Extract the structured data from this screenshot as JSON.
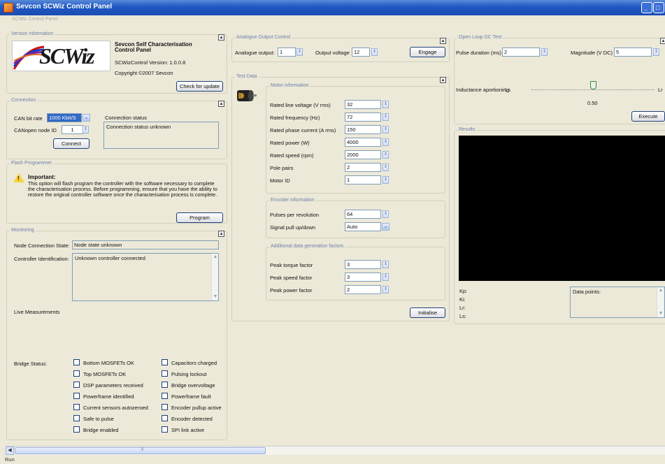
{
  "window": {
    "title": "Sevcon SCWiz Control Panel",
    "minimize": "_",
    "maximize": "□"
  },
  "tab": "SCWiz Control Panel",
  "version": {
    "group_title": "Version Information",
    "logo_text": "SCWiz",
    "product_name": "Sevcon Self Characterisation Control Panel",
    "version_line": "SCWizControl Version: 1.0.0.8",
    "copyright": "Copyright ©2007 Sevcon",
    "check_update": "Check for update"
  },
  "connection": {
    "group_title": "Connection",
    "can_bit_rate_label": "CAN bit rate",
    "can_bit_rate_value": "1000 Kbit/S",
    "node_id_label": "CANopen node ID",
    "node_id_value": "1",
    "connect": "Connect",
    "status_label": "Connection status",
    "status_value": "Connection status unknown"
  },
  "flash": {
    "group_title": "Flash Programmer",
    "important": "Important:",
    "message": "This option will flash program the controller with the software necessary to complete the characterisation process. Before programming, ensure that you have the ability to restore the original controller software once the characterisation process is complete.",
    "program": "Program"
  },
  "monitoring": {
    "group_title": "Monitoring",
    "node_state_label": "Node Connection State:",
    "node_state_value": "Node state unknown",
    "controller_id_label": "Controller Identification:",
    "controller_id_value": "Unknown controller connected",
    "live_label": "Live Measurements",
    "bridge_label": "Bridge Status:",
    "bridge_left": [
      "Bottom MOSFETs OK",
      "Top MOSFETs OK",
      "DSP parameters received",
      "Powerframe identified",
      "Current sensors autozeroed",
      "Safe to pulse",
      "Bridge enabled"
    ],
    "bridge_right": [
      "Capacitors charged",
      "Pulsing lockout",
      "Bridge overvoltage",
      "Powerframe fault",
      "Encoder pullup active",
      "Encoder detected",
      "SPI link active"
    ]
  },
  "analogue": {
    "group_title": "Analogue Output Control",
    "output_label": "Analogue output:",
    "output_value": "1",
    "voltage_label": "Output voltage",
    "voltage_value": "12",
    "engage": "Engage"
  },
  "test_data": {
    "group_title": "Test Data",
    "motor": {
      "title": "Motor information",
      "labels": [
        "Rated line voltage (V rms)",
        "Rated frequency (Hz)",
        "Rated phase current (A rms)",
        "Rated power (W)",
        "Rated speed (rpm)",
        "Pole pairs",
        "Motor ID"
      ],
      "values": [
        "32",
        "72",
        "150",
        "4000",
        "2000",
        "2",
        "1"
      ]
    },
    "encoder": {
      "title": "Encoder information",
      "ppr_label": "Pulses per revolution",
      "ppr_value": "64",
      "pull_label": "Signal pull up/down",
      "pull_value": "Auto"
    },
    "additional": {
      "title": "Additional data generation factors",
      "labels": [
        "Peak torque factor",
        "Peak speed factor",
        "Peak power factor"
      ],
      "values": [
        "3",
        "3",
        "2"
      ]
    },
    "initialise": "Initialise"
  },
  "open_loop": {
    "group_title": "Open Loop DC Test",
    "pulse_label": "Pulse duration (ms)",
    "pulse_value": "2",
    "magnitude_label": "Magnitude (V DC)",
    "magnitude_value": "5",
    "inductance_label": "Inductance aportioning",
    "ls_label": "Ls",
    "lr_label": "Lr",
    "slider_value": "0.50",
    "slider_fraction": 0.5,
    "execute": "Execute"
  },
  "results": {
    "group_title": "Results",
    "kp": "Kp:",
    "ki": "Ki:",
    "lr": "Lr:",
    "ls": "Ls:",
    "data_points": "Data points:"
  },
  "status": "Run"
}
